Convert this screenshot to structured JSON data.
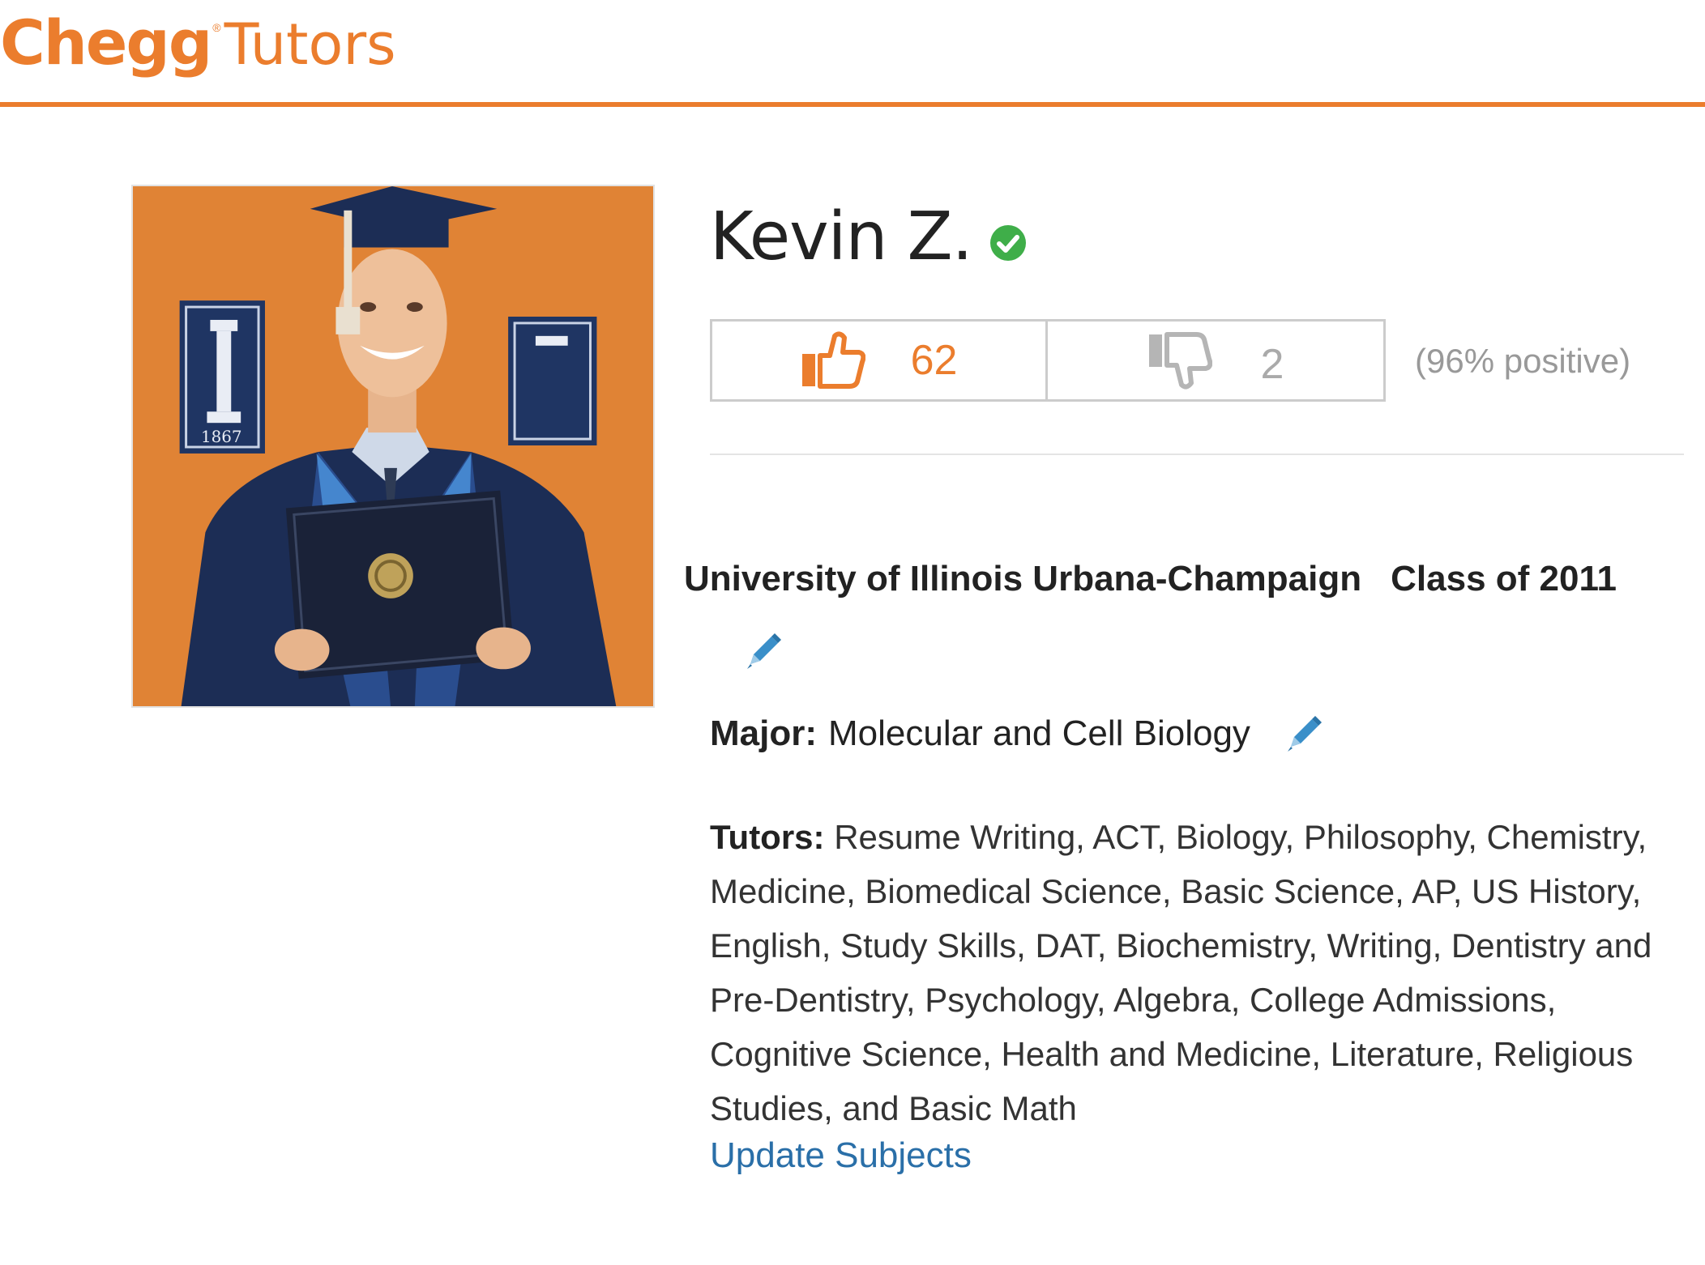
{
  "header": {
    "logo_primary": "Chegg",
    "logo_registered": "®",
    "logo_secondary": "Tutors",
    "accent_color": "#eb7d2d"
  },
  "profile": {
    "name": "Kevin Z.",
    "verified_icon": "verified-check-icon",
    "photo_banner_text": "1867",
    "ratings": {
      "thumbs_up_icon": "thumbs-up-icon",
      "thumbs_up_count": "62",
      "thumbs_down_icon": "thumbs-down-icon",
      "thumbs_down_count": "2",
      "positive_text": "(96% positive)"
    },
    "school": "University of Illinois Urbana-Champaign",
    "class_of": "Class of 2011",
    "edit_icon": "pencil-icon",
    "major_label": "Major:",
    "major_value": "Molecular and Cell Biology",
    "tutors_label": "Tutors:",
    "tutors_value": "Resume Writing, ACT, Biology, Philosophy, Chemistry, Medicine, Biomedical Science, Basic Science, AP, US History, English, Study Skills, DAT, Biochemistry, Writing, Dentistry and Pre-Dentistry, Psychology, Algebra, College Admissions, Cognitive Science, Health and Medicine, Literature, Religious Studies, and Basic Math",
    "update_subjects_label": "Update Subjects"
  }
}
